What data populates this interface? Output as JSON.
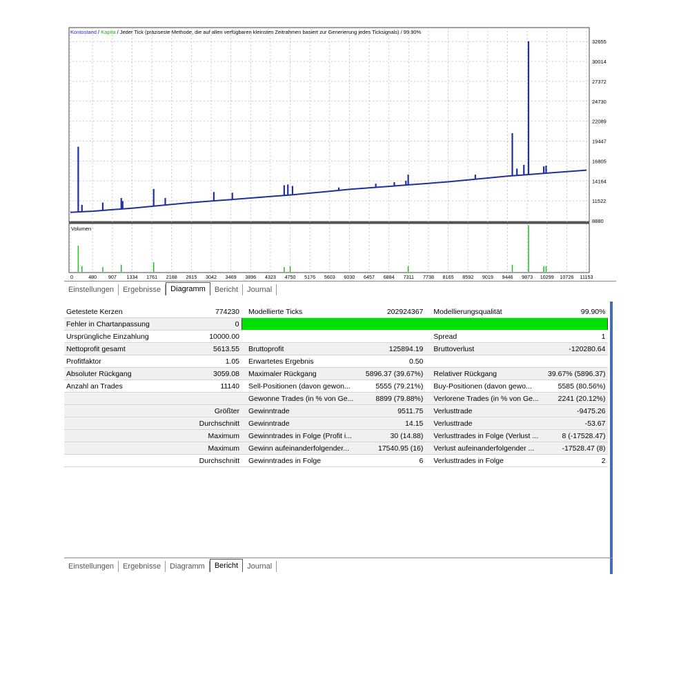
{
  "chart": {
    "header_balance": "Kontostand",
    "header_sep1": " / ",
    "header_equity": "Kapita",
    "header_rest": " / Jeder Tick (präziseste Methode, die auf allen verfügbaren kleinsten Zeitrahmen basiert zur Generierung jedes Ticksignals) / 99.90%",
    "volume_label": "Volumen",
    "colors": {
      "balance": "#1f2f9c",
      "volume": "#22bb22",
      "grid": "#bbbbbb"
    }
  },
  "chart_data": {
    "type": "line",
    "y_ticks": [
      32655,
      30014,
      27372,
      24730,
      22089,
      19447,
      16805,
      14164,
      11522,
      8880
    ],
    "x_ticks": [
      0,
      480,
      907,
      1334,
      1761,
      2188,
      2615,
      3042,
      3469,
      3896,
      4323,
      4750,
      5176,
      5603,
      6030,
      6457,
      6884,
      7311,
      7738,
      8165,
      8592,
      9019,
      9446,
      9873,
      10299,
      10726,
      11153
    ],
    "ylim": [
      8880,
      34500
    ],
    "xlim": [
      0,
      11153
    ],
    "series": [
      {
        "name": "Kontostand",
        "x": [
          0,
          480,
          907,
          1334,
          1761,
          2188,
          2615,
          3042,
          3469,
          3896,
          4323,
          4750,
          5176,
          5603,
          6030,
          6457,
          6884,
          7311,
          7738,
          8165,
          8592,
          9019,
          9446,
          9873,
          10299,
          10726,
          11153
        ],
        "values": [
          10000,
          10150,
          10350,
          10550,
          10800,
          11050,
          11300,
          11500,
          11700,
          11900,
          12100,
          12300,
          12550,
          12800,
          13050,
          13250,
          13450,
          13650,
          13850,
          14050,
          14300,
          14550,
          14800,
          15000,
          15200,
          15400,
          15600
        ]
      }
    ],
    "spikes": [
      {
        "x": 170,
        "value": 18700
      },
      {
        "x": 250,
        "value": 11000
      },
      {
        "x": 700,
        "value": 11300
      },
      {
        "x": 1100,
        "value": 11900
      },
      {
        "x": 1130,
        "value": 11500
      },
      {
        "x": 1800,
        "value": 13100
      },
      {
        "x": 2050,
        "value": 11900
      },
      {
        "x": 3100,
        "value": 12700
      },
      {
        "x": 3500,
        "value": 12600
      },
      {
        "x": 4620,
        "value": 13600
      },
      {
        "x": 4700,
        "value": 13700
      },
      {
        "x": 4800,
        "value": 13500
      },
      {
        "x": 5800,
        "value": 13300
      },
      {
        "x": 6600,
        "value": 13800
      },
      {
        "x": 7000,
        "value": 14000
      },
      {
        "x": 7250,
        "value": 14200
      },
      {
        "x": 7300,
        "value": 15000
      },
      {
        "x": 8750,
        "value": 15000
      },
      {
        "x": 9550,
        "value": 20500
      },
      {
        "x": 9650,
        "value": 15800
      },
      {
        "x": 9800,
        "value": 16300
      },
      {
        "x": 9900,
        "value": 32700
      },
      {
        "x": 10230,
        "value": 16100
      },
      {
        "x": 10280,
        "value": 16200
      }
    ],
    "volume": [
      {
        "x": 170,
        "value": 0.55
      },
      {
        "x": 250,
        "value": 0.12
      },
      {
        "x": 700,
        "value": 0.1
      },
      {
        "x": 1100,
        "value": 0.15
      },
      {
        "x": 1800,
        "value": 0.2
      },
      {
        "x": 4620,
        "value": 0.1
      },
      {
        "x": 4750,
        "value": 0.12
      },
      {
        "x": 7300,
        "value": 0.12
      },
      {
        "x": 9550,
        "value": 0.15
      },
      {
        "x": 9900,
        "value": 0.98
      },
      {
        "x": 10230,
        "value": 0.12
      },
      {
        "x": 10280,
        "value": 0.12
      }
    ]
  },
  "tabs_top": [
    {
      "label": "Einstellungen",
      "active": false
    },
    {
      "label": "Ergebnisse",
      "active": false
    },
    {
      "label": "Diagramm",
      "active": true
    },
    {
      "label": "Bericht",
      "active": false
    },
    {
      "label": "Journal",
      "active": false
    }
  ],
  "tabs_bottom": [
    {
      "label": "Einstellungen",
      "active": false
    },
    {
      "label": "Ergebnisse",
      "active": false
    },
    {
      "label": "Diagramm",
      "active": false
    },
    {
      "label": "Bericht",
      "active": true
    },
    {
      "label": "Journal",
      "active": false
    }
  ],
  "report": {
    "rows": [
      [
        "Getestete Kerzen",
        "774230",
        "Modellierte Ticks",
        "202924367",
        "Modellierungsqualität",
        "99.90%"
      ],
      [
        "Fehler in Chartanpassung",
        "0",
        "",
        "",
        "",
        ""
      ],
      [
        "Ursprüngliche Einzahlung",
        "10000.00",
        "",
        "",
        "Spread",
        "1"
      ],
      [
        "Nettoprofit gesamt",
        "5613.55",
        "Bruttoprofit",
        "125894.19",
        "Bruttoverlust",
        "-120280.64"
      ],
      [
        "Profitfaktor",
        "1.05",
        "Erwartetes Ergebnis",
        "0.50",
        "",
        ""
      ],
      [
        "Absoluter Rückgang",
        "3059.08",
        "Maximaler Rückgang",
        "5896.37 (39.67%)",
        "Relativer Rückgang",
        "39.67% (5896.37)"
      ],
      [
        "Anzahl an Trades",
        "11140",
        "Sell-Positionen (davon gewon...",
        "5555 (79.21%)",
        "Buy-Positionen (davon gewo...",
        "5585 (80.56%)"
      ],
      [
        "",
        "",
        "Gewonne Trades (in % von Ge...",
        "8899 (79.88%)",
        "Verlorene Trades (in % von Ge...",
        "2241 (20.12%)"
      ],
      [
        "",
        "Größter",
        "Gewinntrade",
        "9511.75",
        "Verlusttrade",
        "-9475.26"
      ],
      [
        "",
        "Durchschnitt",
        "Gewinntrade",
        "14.15",
        "Verlusttrade",
        "-53.67"
      ],
      [
        "",
        "Maximum",
        "Gewinntrades in Folge (Profit i...",
        "30 (14.88)",
        "Verlusttrades in Folge (Verlust ...",
        "8 (-17528.47)"
      ],
      [
        "",
        "Maximum",
        "Gewinn aufeinanderfolgender...",
        "17540.95 (16)",
        "Verlust aufeinanderfolgender ...",
        "-17528.47 (8)"
      ],
      [
        "",
        "Durchschnitt",
        "Gewinntrades in Folge",
        "6",
        "Verlusttrades in Folge",
        "2"
      ]
    ],
    "quality_bar_color": "#00e000"
  }
}
